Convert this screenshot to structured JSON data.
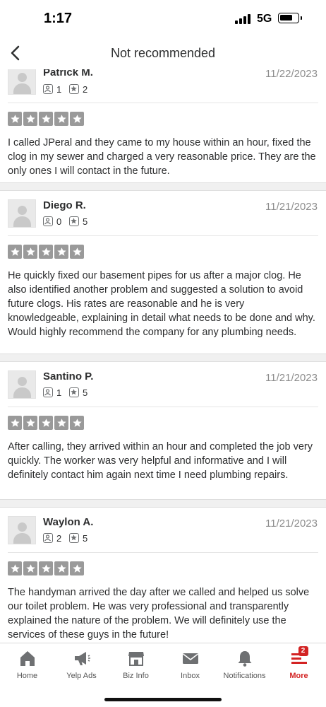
{
  "status_bar": {
    "time": "1:17",
    "network": "5G"
  },
  "header": {
    "title": "Not recommended"
  },
  "reviews": [
    {
      "name": "Patrick M.",
      "date": "11/22/2023",
      "friends": "1",
      "reviews_count": "2",
      "rating": 5,
      "text": "I called JPeral and they came to my house within an hour, fixed the clog in my sewer and charged a very reasonable price. They are the only ones I will contact in the future."
    },
    {
      "name": "Diego R.",
      "date": "11/21/2023",
      "friends": "0",
      "reviews_count": "5",
      "rating": 5,
      "text": "He quickly fixed our basement pipes for us after a major clog. He also identified another problem and suggested a solution to avoid future clogs. His rates are reasonable and he is very knowledgeable, explaining in detail what needs to be done and why. Would highly recommend the company for any plumbing needs."
    },
    {
      "name": "Santino P.",
      "date": "11/21/2023",
      "friends": "1",
      "reviews_count": "5",
      "rating": 5,
      "text": "After calling, they arrived within an hour and completed the job very quickly. The worker was very helpful and informative and I will definitely contact him again next time I need plumbing repairs."
    },
    {
      "name": "Waylon A.",
      "date": "11/21/2023",
      "friends": "2",
      "reviews_count": "5",
      "rating": 5,
      "text": "The handyman arrived the day after we called and helped us solve our toilet problem. He was very professional and transparently explained the nature of the problem. We will definitely use the services of these guys in the future!"
    }
  ],
  "tabs": [
    {
      "label": "Home",
      "icon": "home-icon"
    },
    {
      "label": "Yelp Ads",
      "icon": "megaphone-icon"
    },
    {
      "label": "Biz Info",
      "icon": "storefront-icon"
    },
    {
      "label": "Inbox",
      "icon": "envelope-icon"
    },
    {
      "label": "Notifications",
      "icon": "bell-icon"
    },
    {
      "label": "More",
      "icon": "more-list-icon",
      "badge": "2",
      "active": true
    }
  ],
  "colors": {
    "accent": "#d32323",
    "star_bg": "#9a9a9a",
    "text": "#2d2e2f",
    "muted": "#8d8d8d"
  }
}
